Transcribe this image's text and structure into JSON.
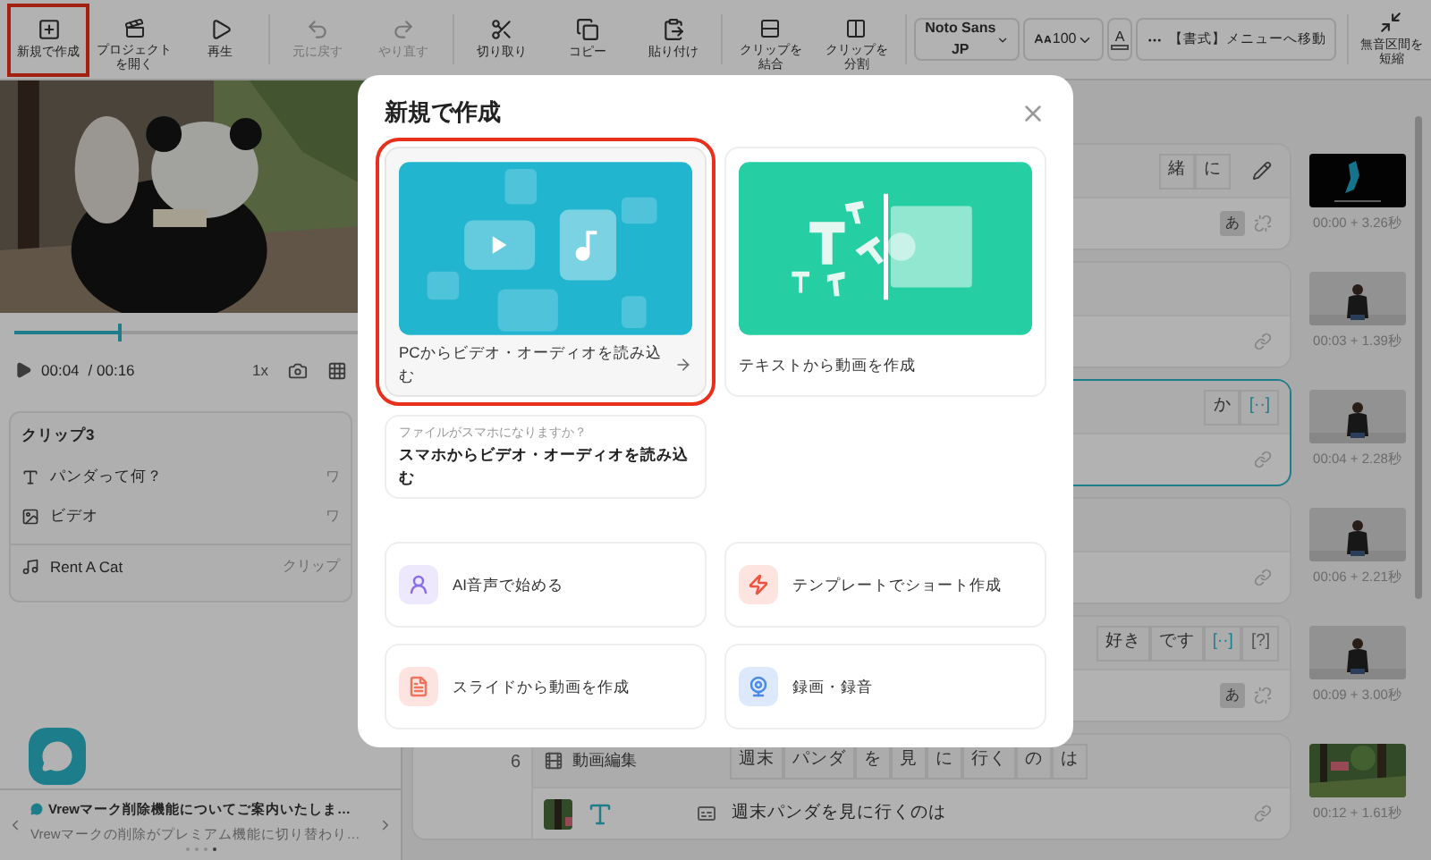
{
  "toolbar": {
    "items": [
      {
        "label": "新規で作成",
        "highlighted": true,
        "disabled": false
      },
      {
        "label": "プロジェクトを開く",
        "highlighted": false,
        "disabled": false
      },
      {
        "label": "再生",
        "highlighted": false,
        "disabled": false
      },
      {
        "label": "元に戻す",
        "highlighted": false,
        "disabled": true
      },
      {
        "label": "やり直す",
        "highlighted": false,
        "disabled": true
      },
      {
        "label": "切り取り",
        "highlighted": false,
        "disabled": false
      },
      {
        "label": "コピー",
        "highlighted": false,
        "disabled": false
      },
      {
        "label": "貼り付け",
        "highlighted": false,
        "disabled": false
      },
      {
        "label": "クリップを結合",
        "highlighted": false,
        "disabled": false
      },
      {
        "label": "クリップを分割",
        "highlighted": false,
        "disabled": false
      }
    ],
    "font_select": {
      "value": "Noto Sans JP"
    },
    "font_size": {
      "value": "100"
    },
    "color_button": {
      "label": "A"
    },
    "format_menu": {
      "label": "【書式】メニューへ移動"
    },
    "trim_silence": {
      "label": "無音区間を短縮"
    }
  },
  "player": {
    "progress": {
      "level": 0.28
    },
    "current_time": "00:04",
    "total_time": "/ 00:16",
    "speed": "1x"
  },
  "clip_panel": {
    "title": "クリップ3",
    "rows": [
      {
        "kind": "text",
        "label": "パンダって何？",
        "value": "ワ"
      },
      {
        "kind": "video",
        "label": "ビデオ",
        "value": "ワ"
      },
      {
        "kind": "music",
        "label": "Rent A Cat",
        "value": "クリップ"
      }
    ]
  },
  "notice": {
    "title": "Vrewマーク削除機能についてご案内いたしま…",
    "body": "Vrewマークの削除がプレミアム機能に切り替わり…",
    "pages": [
      {
        "selected": false
      },
      {
        "selected": false
      },
      {
        "selected": false
      },
      {
        "selected": true
      }
    ]
  },
  "clips": [
    {
      "selected": false,
      "words": [
        {
          "text": "緒",
          "kind": "word"
        },
        {
          "text": "に",
          "kind": "word"
        }
      ],
      "editable": true,
      "kana_badge": "あ",
      "linked": false,
      "time": "00:00 + 3.26秒"
    },
    {
      "selected": false,
      "editable": false,
      "linked": true,
      "time": "00:03 + 1.39秒"
    },
    {
      "selected": true,
      "words": [
        {
          "text": "か",
          "kind": "word"
        },
        {
          "text": "[··]",
          "kind": "pause"
        }
      ],
      "editable": false,
      "linked": true,
      "time": "00:04 + 2.28秒"
    },
    {
      "selected": false,
      "editable": false,
      "linked": true,
      "time": "00:06 + 2.21秒"
    },
    {
      "selected": false,
      "words": [
        {
          "text": "好き",
          "kind": "word"
        },
        {
          "text": "です",
          "kind": "word"
        },
        {
          "text": "[··]",
          "kind": "pause"
        },
        {
          "text": "[?]",
          "kind": "unknown"
        }
      ],
      "editable": false,
      "kana_badge": "あ",
      "linked": false,
      "time": "00:09 + 3.00秒"
    },
    {
      "selected": false,
      "number": "6",
      "label": "動画編集",
      "words": [
        {
          "text": "週末",
          "kind": "word"
        },
        {
          "text": "パンダ",
          "kind": "word"
        },
        {
          "text": "を",
          "kind": "word"
        },
        {
          "text": "見",
          "kind": "word"
        },
        {
          "text": "に",
          "kind": "word"
        },
        {
          "text": "行く",
          "kind": "word"
        },
        {
          "text": "の",
          "kind": "word"
        },
        {
          "text": "は",
          "kind": "word"
        }
      ],
      "editable": false,
      "subtitle": "週末パンダを見に行くのは",
      "linked": true,
      "time": "00:12 + 1.61秒"
    }
  ],
  "dialog": {
    "title": "新規で作成",
    "main_options": [
      {
        "kind": "import",
        "label": "PCからビデオ・オーディオを読み込む",
        "highlighted": true
      },
      {
        "kind": "text",
        "label": "テキストから動画を作成",
        "highlighted": false
      }
    ],
    "phone_option": {
      "hint": "ファイルがスマホになりますか？",
      "label": "スマホからビデオ・オーディオを読み込む"
    },
    "options": [
      {
        "kind": "ai",
        "label": "AI音声で始める"
      },
      {
        "kind": "template",
        "label": "テンプレートでショート作成"
      },
      {
        "kind": "slide",
        "label": "スライドから動画を作成"
      },
      {
        "kind": "record",
        "label": "録画・録音"
      }
    ]
  }
}
